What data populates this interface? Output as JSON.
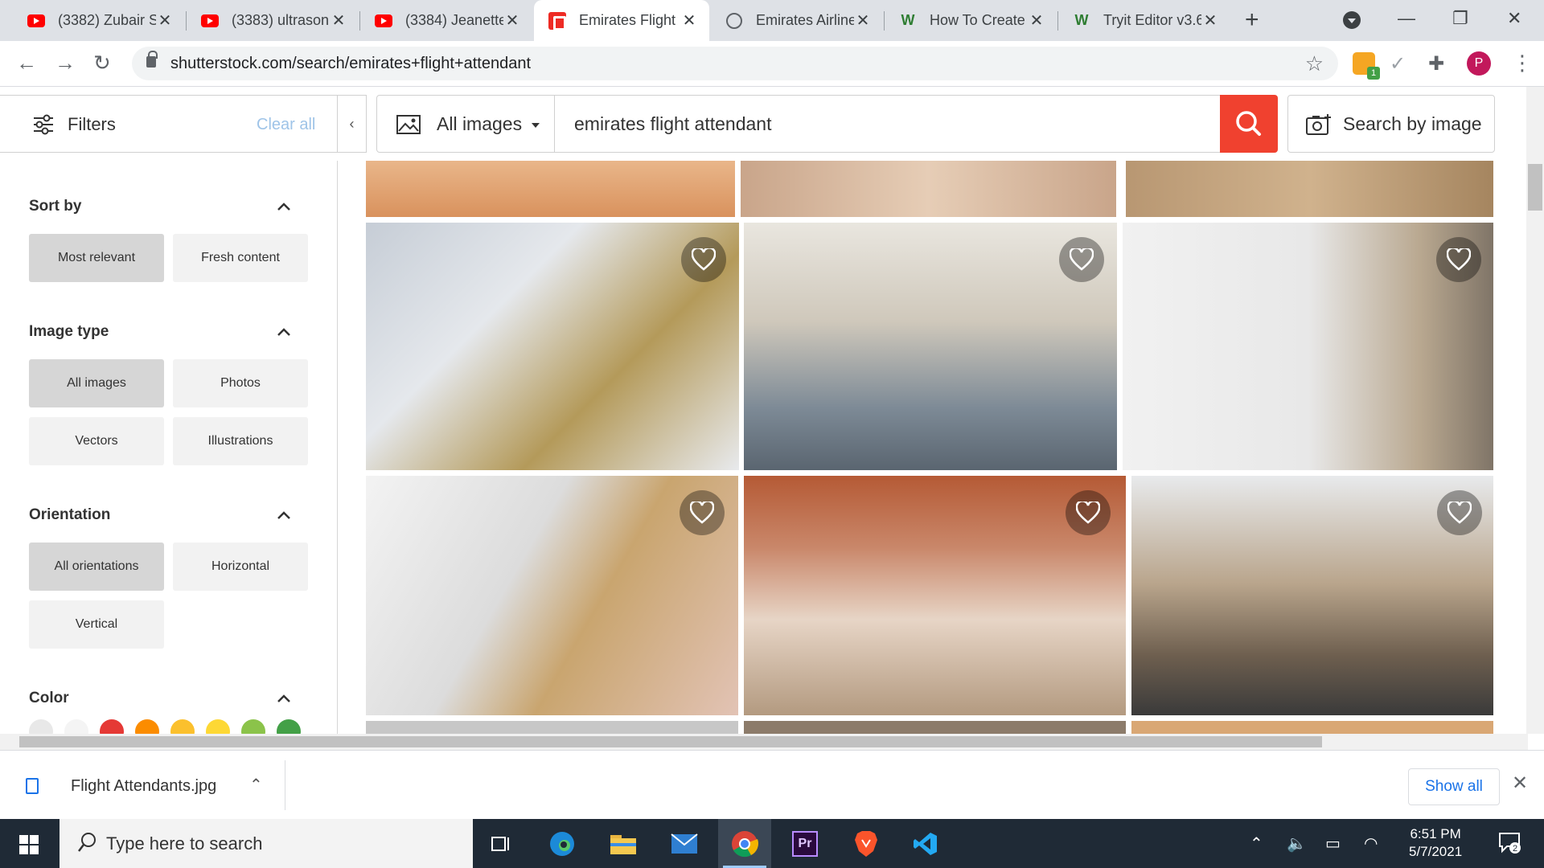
{
  "browser": {
    "tabs": [
      {
        "title": "(3382) Zubair S",
        "icon": "youtube-icon"
      },
      {
        "title": "(3383) ultrason",
        "icon": "youtube-icon"
      },
      {
        "title": "(3384) Jeanette",
        "icon": "youtube-icon"
      },
      {
        "title": "Emirates Flight",
        "icon": "shutterstock-icon",
        "active": true
      },
      {
        "title": "Emirates Airline",
        "icon": "globe-icon"
      },
      {
        "title": "How To Create",
        "icon": "w-logo-icon"
      },
      {
        "title": "Tryit Editor v3.6",
        "icon": "w-logo-icon"
      }
    ],
    "url": "shutterstock.com/search/emirates+flight+attendant",
    "profile_initial": "P",
    "extension_badge": "1"
  },
  "filters": {
    "label": "Filters",
    "clear_all": "Clear all"
  },
  "search": {
    "type_label": "All images",
    "query": "emirates flight attendant",
    "by_image_label": "Search by image"
  },
  "sidebar": {
    "sort_by": {
      "title": "Sort by",
      "options": [
        "Most relevant",
        "Fresh content"
      ],
      "selected": "Most relevant"
    },
    "image_type": {
      "title": "Image type",
      "options": [
        "All images",
        "Photos",
        "Vectors",
        "Illustrations"
      ],
      "selected": "All images"
    },
    "orientation": {
      "title": "Orientation",
      "options": [
        "All orientations",
        "Horizontal",
        "Vertical"
      ],
      "selected": "All orientations"
    },
    "color": {
      "title": "Color",
      "swatches": [
        "#e8e8e8",
        "#f4f4f4",
        "#e53935",
        "#fb8c00",
        "#fbc02d",
        "#fdd835",
        "#8bc34a",
        "#43a047"
      ]
    }
  },
  "downloads": {
    "file_name": "Flight Attendants.jpg",
    "show_all": "Show all"
  },
  "taskbar": {
    "search_placeholder": "Type here to search",
    "time": "6:51 PM",
    "date": "5/7/2021",
    "notification_count": "2"
  }
}
